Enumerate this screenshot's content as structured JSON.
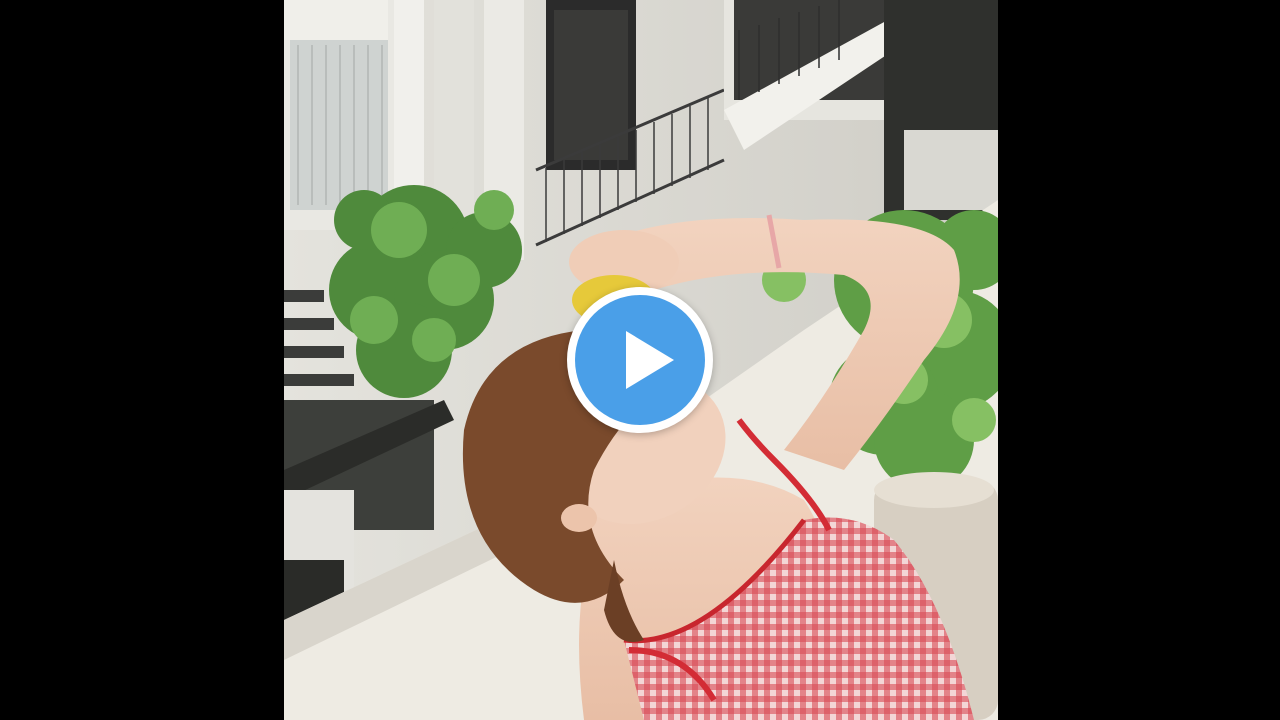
{
  "video": {
    "state": "paused"
  },
  "controls": {
    "play_icon": "play-icon",
    "accent_color": "#4a9fe8"
  },
  "thumbnail": {
    "kind": "photo"
  }
}
